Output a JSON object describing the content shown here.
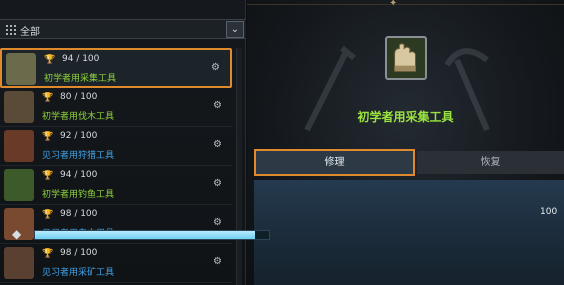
{
  "filter": {
    "label": "全部",
    "dropdown_icon": "chevron-down-icon"
  },
  "tools": [
    {
      "count": "94 / 100",
      "name": "初学者用采集工具",
      "name_color": "green",
      "selected": true,
      "thumb_color": "#6b6a4a"
    },
    {
      "count": "80 / 100",
      "name": "初学者用伐木工具",
      "name_color": "green",
      "selected": false,
      "thumb_color": "#5a4a38"
    },
    {
      "count": "92 / 100",
      "name": "见习者用狩猎工具",
      "name_color": "blue",
      "selected": false,
      "thumb_color": "#6a3a28"
    },
    {
      "count": "94 / 100",
      "name": "初学者用钓鱼工具",
      "name_color": "green",
      "selected": false,
      "thumb_color": "#3d5a2a"
    },
    {
      "count": "98 / 100",
      "name": "见习者用考古用具",
      "name_color": "blue",
      "selected": false,
      "thumb_color": "#7a4a30"
    },
    {
      "count": "98 / 100",
      "name": "见习者用采矿工具",
      "name_color": "blue",
      "selected": false,
      "thumb_color": "#5a4030"
    }
  ],
  "detail": {
    "name": "初学者用采集工具",
    "tabs": {
      "repair": "修理",
      "restore": "恢复"
    },
    "durability_max": "100",
    "durability_fraction": 0.94
  },
  "colors": {
    "highlight": "#e08a2e",
    "uncommon": "#8fd43c",
    "rare": "#3fa3e8"
  }
}
